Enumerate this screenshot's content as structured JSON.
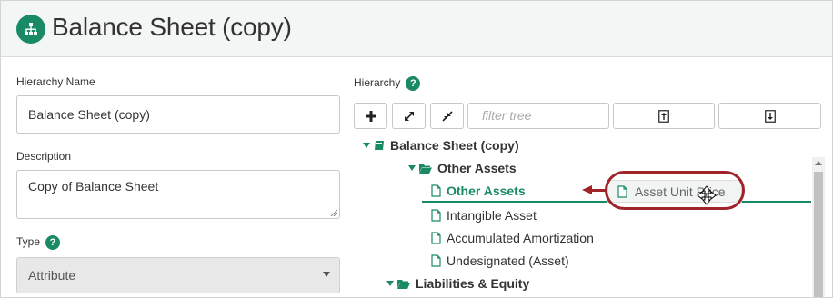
{
  "header": {
    "title": "Balance Sheet (copy)",
    "icon": "hierarchy-icon",
    "accent": "#1a8a66"
  },
  "form": {
    "name_label": "Hierarchy Name",
    "name_value": "Balance Sheet (copy)",
    "description_label": "Description",
    "description_value": "Copy of Balance Sheet",
    "type_label": "Type",
    "type_value": "Attribute",
    "help_glyph": "?"
  },
  "hierarchy": {
    "label": "Hierarchy",
    "filter_placeholder": "filter tree",
    "toolbar_icons": [
      "add-icon",
      "expand-icon",
      "collapse-icon",
      "upload-icon",
      "download-icon"
    ],
    "tree": {
      "root": "Balance Sheet (copy)",
      "group1": "Other Assets",
      "items": [
        "Other Assets",
        "Intangible Asset",
        "Accumulated Amortization",
        "Undesignated (Asset)"
      ],
      "group2": "Liabilities & Equity"
    },
    "drag_item": "Asset Unit Price"
  },
  "annotation_color": "#a0232a"
}
